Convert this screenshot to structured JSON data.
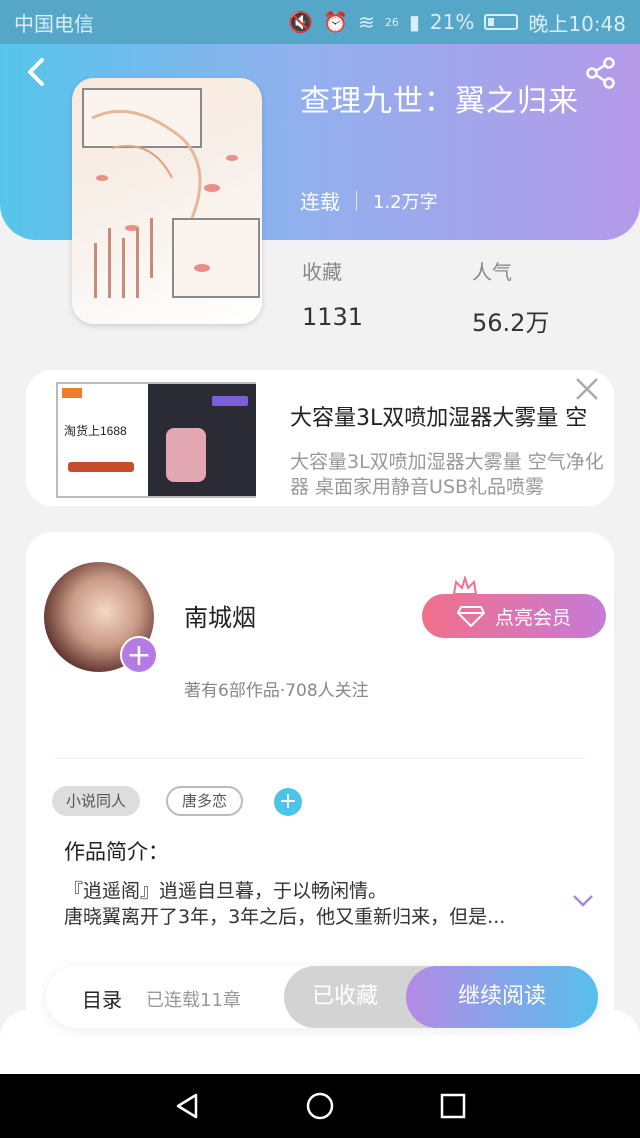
{
  "status_bar": {
    "carrier": "中国电信",
    "network": "26",
    "battery": "21%",
    "time": "晚上10:48"
  },
  "book": {
    "title": "查理九世：翼之归来",
    "status": "连载",
    "word_count": "1.2万字",
    "favorites_label": "收藏",
    "favorites_value": "1131",
    "popularity_label": "人气",
    "popularity_value": "56.2万"
  },
  "ad": {
    "title": "大容量3L双喷加湿器大雾量 空",
    "description": "大容量3L双喷加湿器大雾量 空气净化器 桌面家用静音USB礼品喷雾",
    "image_caption": "淘货上1688"
  },
  "author": {
    "name": "南城烟",
    "info": "著有6部作品·708人关注",
    "vip_button": "点亮会员"
  },
  "tags": [
    "小说同人",
    "唐多恋"
  ],
  "intro": {
    "label": "作品简介：",
    "text_line1": "『逍遥阁』逍遥自旦暮，于以畅闲情。",
    "text_line2": "唐晓翼离开了3年，3年之后，他又重新归来，但是..."
  },
  "bottom_bar": {
    "toc_label": "目录",
    "toc_count": "已连载11章",
    "favorited_button": "已收藏",
    "continue_button": "继续阅读"
  },
  "icons": {
    "back": "back-arrow-icon",
    "share": "share-icon",
    "close": "close-icon",
    "plus": "plus-icon",
    "diamond": "diamond-icon",
    "crown": "crown-icon",
    "expand": "chevron-down-icon"
  },
  "colors": {
    "header_gradient_start": "#55c6ea",
    "header_gradient_end": "#b59ae9",
    "vip_gradient_start": "#f2708b",
    "vip_gradient_end": "#c67ad6",
    "read_gradient_start": "#b48ae6",
    "read_gradient_end": "#57bfec"
  }
}
